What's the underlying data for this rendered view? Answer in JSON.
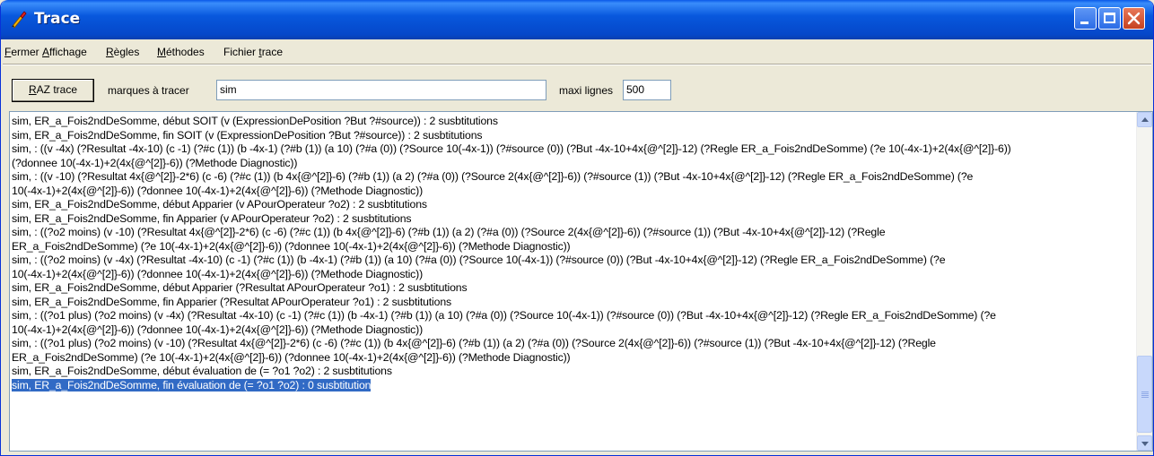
{
  "window": {
    "title": "Trace"
  },
  "menu": [
    {
      "before": "",
      "accel": "F",
      "after": "ermer"
    },
    {
      "before": "",
      "accel": "A",
      "after": "ffichage"
    },
    {
      "before": "",
      "accel": "R",
      "after": "ègles"
    },
    {
      "before": "",
      "accel": "M",
      "after": "éthodes"
    },
    {
      "before": "Fichier ",
      "accel": "t",
      "after": "race"
    }
  ],
  "toolbar": {
    "raz_accel": "R",
    "raz_rest": "AZ trace",
    "marques_label": "marques à tracer",
    "marques_value": "sim",
    "maxi_label": "maxi lignes",
    "maxi_value": "500"
  },
  "trace_lines": [
    "sim, ER_a_Fois2ndDeSomme, début SOIT (v (ExpressionDePosition ?But ?#source)) : 2 susbtitutions",
    "sim, ER_a_Fois2ndDeSomme, fin SOIT (v (ExpressionDePosition ?But ?#source)) : 2 susbtitutions",
    "sim, : ((v -4x) (?Resultat -4x-10) (c -1) (?#c (1)) (b -4x-1) (?#b (1)) (a 10) (?#a (0)) (?Source 10(-4x-1)) (?#source (0)) (?But -4x-10+4x{@^[2]}-12) (?Regle ER_a_Fois2ndDeSomme) (?e 10(-4x-1)+2(4x{@^[2]}-6))",
    "(?donnee 10(-4x-1)+2(4x{@^[2]}-6)) (?Methode Diagnostic))",
    "sim, : ((v -10) (?Resultat 4x{@^[2]}-2*6) (c -6) (?#c (1)) (b 4x{@^[2]}-6) (?#b (1)) (a 2) (?#a (0)) (?Source 2(4x{@^[2]}-6)) (?#source (1)) (?But -4x-10+4x{@^[2]}-12) (?Regle ER_a_Fois2ndDeSomme) (?e",
    "10(-4x-1)+2(4x{@^[2]}-6)) (?donnee 10(-4x-1)+2(4x{@^[2]}-6)) (?Methode Diagnostic))",
    "sim, ER_a_Fois2ndDeSomme, début Apparier (v APourOperateur ?o2) : 2 susbtitutions",
    "sim, ER_a_Fois2ndDeSomme, fin Apparier (v APourOperateur ?o2) : 2 susbtitutions",
    "sim, : ((?o2 moins) (v -10) (?Resultat 4x{@^[2]}-2*6) (c -6) (?#c (1)) (b 4x{@^[2]}-6) (?#b (1)) (a 2) (?#a (0)) (?Source 2(4x{@^[2]}-6)) (?#source (1)) (?But -4x-10+4x{@^[2]}-12) (?Regle",
    "ER_a_Fois2ndDeSomme) (?e 10(-4x-1)+2(4x{@^[2]}-6)) (?donnee 10(-4x-1)+2(4x{@^[2]}-6)) (?Methode Diagnostic))",
    "sim, : ((?o2 moins) (v -4x) (?Resultat -4x-10) (c -1) (?#c (1)) (b -4x-1) (?#b (1)) (a 10) (?#a (0)) (?Source 10(-4x-1)) (?#source (0)) (?But -4x-10+4x{@^[2]}-12) (?Regle ER_a_Fois2ndDeSomme) (?e",
    "10(-4x-1)+2(4x{@^[2]}-6)) (?donnee 10(-4x-1)+2(4x{@^[2]}-6)) (?Methode Diagnostic))",
    "sim, ER_a_Fois2ndDeSomme, début Apparier (?Resultat APourOperateur ?o1) : 2 susbtitutions",
    "sim, ER_a_Fois2ndDeSomme, fin Apparier (?Resultat APourOperateur ?o1) : 2 susbtitutions",
    "sim, : ((?o1 plus) (?o2 moins) (v -4x) (?Resultat -4x-10) (c -1) (?#c (1)) (b -4x-1) (?#b (1)) (a 10) (?#a (0)) (?Source 10(-4x-1)) (?#source (0)) (?But -4x-10+4x{@^[2]}-12) (?Regle ER_a_Fois2ndDeSomme) (?e",
    "10(-4x-1)+2(4x{@^[2]}-6)) (?donnee 10(-4x-1)+2(4x{@^[2]}-6)) (?Methode Diagnostic))",
    "sim, : ((?o1 plus) (?o2 moins) (v -10) (?Resultat 4x{@^[2]}-2*6) (c -6) (?#c (1)) (b 4x{@^[2]}-6) (?#b (1)) (a 2) (?#a (0)) (?Source 2(4x{@^[2]}-6)) (?#source (1)) (?But -4x-10+4x{@^[2]}-12) (?Regle",
    "ER_a_Fois2ndDeSomme) (?e 10(-4x-1)+2(4x{@^[2]}-6)) (?donnee 10(-4x-1)+2(4x{@^[2]}-6)) (?Methode Diagnostic))",
    "sim, ER_a_Fois2ndDeSomme, début évaluation de (= ?o1 ?o2) : 2 susbtitutions",
    "sim, ER_a_Fois2ndDeSomme, fin évaluation de (= ?o1 ?o2) : 0 susbtitution"
  ],
  "selected_line": 19,
  "icons": [
    "app-trace-icon",
    "minimize-icon",
    "maximize-icon",
    "close-icon",
    "scroll-up-arrow-icon",
    "scroll-down-arrow-icon"
  ],
  "colors": {
    "titlebar": "#0858dd",
    "selection": "#316ac5",
    "window_bg": "#ece9d8"
  }
}
